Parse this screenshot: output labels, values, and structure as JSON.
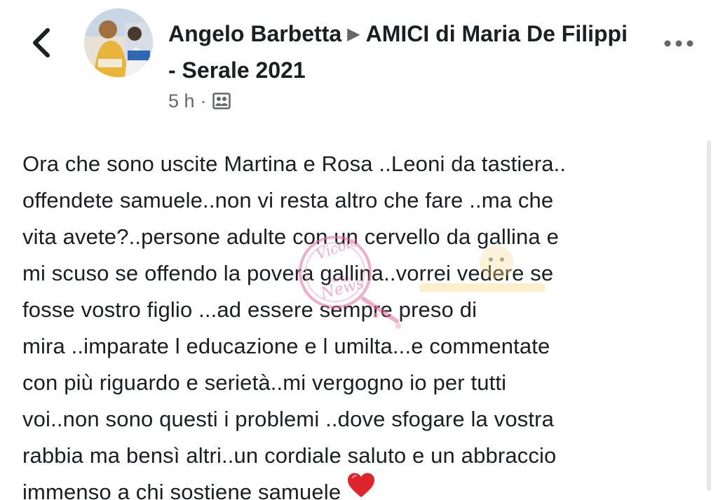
{
  "post": {
    "author": "Angelo Barbetta",
    "group": "AMICI di Maria De Filippi - Serale 2021",
    "time": "5 h",
    "body_lines": [
      "Ora che sono uscite Martina e Rosa ..Leoni da tastiera..",
      "offendete samuele..non vi resta altro che fare ..ma che",
      "vita avete?..persone adulte con un cervello da gallina e",
      "mi scuso se offendo la povera gallina..vorrei vedere se",
      "fosse vostro figlio ...ad essere sempre preso di",
      "mira ..imparate l educazione e l umilta...e commentate",
      "con più riguardo e serietà..mi vergogno io per tutti",
      "voi..non sono questi i problemi ..dove sfogare la vostra",
      "rabbia ma bensì altri..un cordiale saluto e un abbraccio",
      "immenso a chi sostiene samuele"
    ],
    "emoji": "❤️"
  },
  "icons": {
    "back": "chevron-left-icon",
    "more": "more-horizontal-icon",
    "privacy": "group-privacy-icon",
    "heart": "red-heart-icon",
    "group_arrow": "triangle-right-icon"
  },
  "colors": {
    "text": "#1c1e21",
    "secondary": "#65676b",
    "heart": "#e0242b",
    "watermark_pink": "#e86aa0"
  }
}
